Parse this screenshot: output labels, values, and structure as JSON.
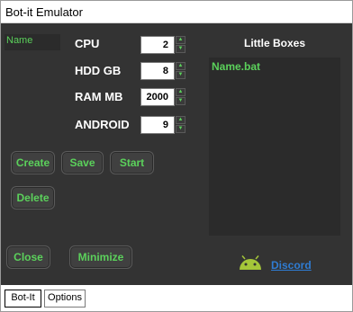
{
  "window": {
    "title": "Bot-it Emulator"
  },
  "name_field": {
    "value": "Name"
  },
  "specs": [
    {
      "label": "CPU",
      "value": "2"
    },
    {
      "label": "HDD GB",
      "value": "8"
    },
    {
      "label": "RAM MB",
      "value": "2000"
    },
    {
      "label": "ANDROID",
      "value": "9"
    }
  ],
  "actions": {
    "create": "Create",
    "save": "Save",
    "start": "Start",
    "delete": "Delete",
    "close": "Close",
    "minimize": "Minimize"
  },
  "little_boxes": {
    "title": "Little Boxes",
    "items": [
      "Name.bat"
    ]
  },
  "footer": {
    "link": "Discord",
    "icon": "android-icon"
  },
  "tabs": [
    {
      "label": "Bot-It",
      "active": true
    },
    {
      "label": "Options",
      "active": false
    }
  ],
  "colors": {
    "background": "#333333",
    "accent_green": "#5bd15b",
    "link_blue": "#2f7cd3"
  }
}
